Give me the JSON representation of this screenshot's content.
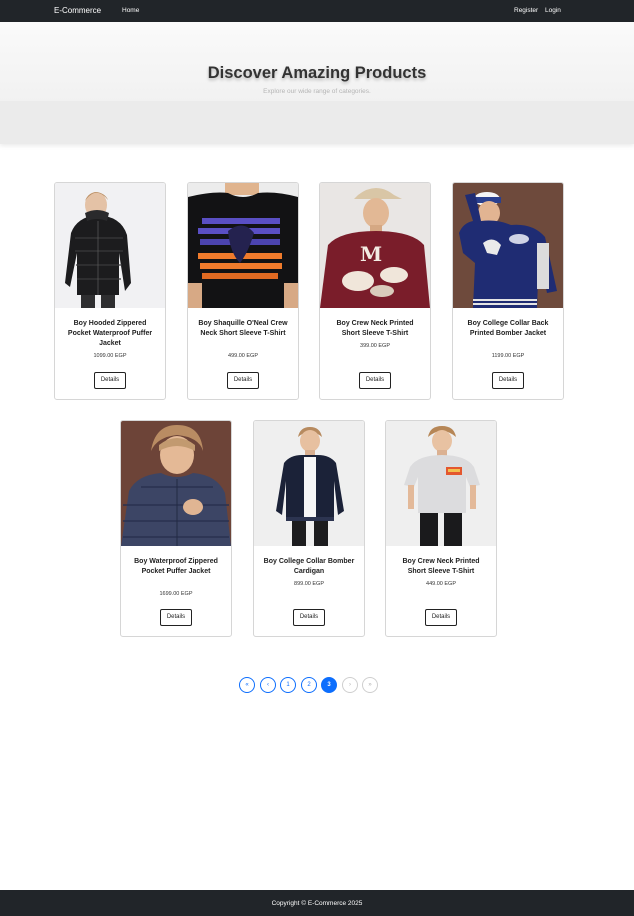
{
  "navbar": {
    "brand": "E-Commerce",
    "home": "Home",
    "register": "Register",
    "login": "Login"
  },
  "hero": {
    "title": "Discover Amazing Products",
    "subtitle": "Explore our wide range of categories."
  },
  "products": [
    {
      "title": "Boy Hooded Zippered Pocket Waterproof Puffer Jacket",
      "price": "1099.00 EGP",
      "details_label": "Details",
      "image": "black-puffer-jacket"
    },
    {
      "title": "Boy Shaquille O'Neal Crew Neck Short Sleeve T-Shirt",
      "price": "499.00 EGP",
      "details_label": "Details",
      "image": "black-graphic-tshirt"
    },
    {
      "title": "Boy Crew Neck Printed Short Sleeve T-Shirt",
      "price": "399.00 EGP",
      "details_label": "Details",
      "image": "maroon-printed-tshirt"
    },
    {
      "title": "Boy College Collar Back Printed Bomber Jacket",
      "price": "1199.00 EGP",
      "details_label": "Details",
      "image": "blue-bomber-jacket"
    },
    {
      "title": "Boy Waterproof Zippered Pocket Puffer Jacket",
      "price": "1699.00 EGP",
      "details_label": "Details",
      "image": "navy-puffer-jacket"
    },
    {
      "title": "Boy College Collar Bomber Cardigan",
      "price": "899.00 EGP",
      "details_label": "Details",
      "image": "navy-bomber-cardigan"
    },
    {
      "title": "Boy Crew Neck Printed Short Sleeve T-Shirt",
      "price": "449.00 EGP",
      "details_label": "Details",
      "image": "grey-printed-tshirt"
    }
  ],
  "pagination": {
    "first": "«",
    "prev": "‹",
    "pages": [
      "1",
      "2",
      "3"
    ],
    "active_page": "3",
    "next": "›",
    "last": "»"
  },
  "footer": {
    "copyright": "Copyright © E-Commerce 2025"
  },
  "colors": {
    "navbar_bg": "#212529",
    "accent": "#0d6efd"
  }
}
